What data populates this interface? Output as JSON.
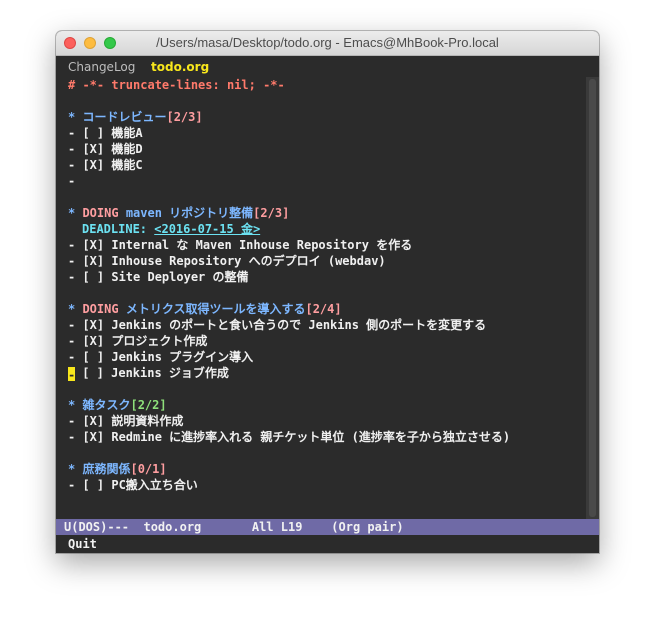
{
  "window": {
    "title": "/Users/masa/Desktop/todo.org - Emacs@MhBook-Pro.local"
  },
  "tabs": [
    {
      "label": "ChangeLog",
      "active": false
    },
    {
      "label": "todo.org",
      "active": true
    }
  ],
  "buffer": {
    "header": "# -*- truncate-lines: nil; -*-",
    "sec1": {
      "star": "* ",
      "title": "コードレビュー",
      "count": "[2/3]"
    },
    "sec1_items": [
      "- [ ] 機能A",
      "- [X] 機能D",
      "- [X] 機能C",
      "-"
    ],
    "sec2": {
      "star": "* ",
      "keyword": "DOING ",
      "title": "maven リポジトリ整備",
      "count": "[2/3]"
    },
    "sec2_deadline_label": "DEADLINE: ",
    "sec2_deadline_value": "<2016-07-15 金>",
    "sec2_items": [
      "- [X] Internal な Maven Inhouse Repository を作る",
      "- [X] Inhouse Repository へのデプロイ (webdav)",
      "- [ ] Site Deployer の整備"
    ],
    "sec3": {
      "star": "* ",
      "keyword": "DOING ",
      "title": "メトリクス取得ツールを導入する",
      "count": "[2/4]"
    },
    "sec3_items": [
      "- [X] Jenkins のポートと食い合うので Jenkins 側のポートを変更する",
      "- [X] プロジェクト作成",
      "- [ ] Jenkins プラグイン導入",
      " [ ] Jenkins ジョブ作成"
    ],
    "cursor_char": "-",
    "sec4": {
      "star": "* ",
      "title": "雑タスク",
      "count": "[2/2]"
    },
    "sec4_items": [
      "- [X] 説明資料作成",
      "- [X] Redmine に進捗率入れる 親チケット単位 (進捗率を子から独立させる)"
    ],
    "sec5": {
      "star": "* ",
      "title": "庶務関係",
      "count": "[0/1]"
    },
    "sec5_items": [
      "- [ ] PC搬入立ち合い"
    ]
  },
  "modeline": "U(DOS)---  todo.org       All L19    (Org pair)",
  "minibuffer": "Quit",
  "colors": {
    "background": "#2b2b2b",
    "heading": "#7db7ff",
    "count_done": "#8ee07a",
    "count_pending": "#ff9ea0",
    "deadline": "#6ce2f2",
    "cursor": "#f8e71c",
    "modeline_bg": "#6f6aa6"
  }
}
